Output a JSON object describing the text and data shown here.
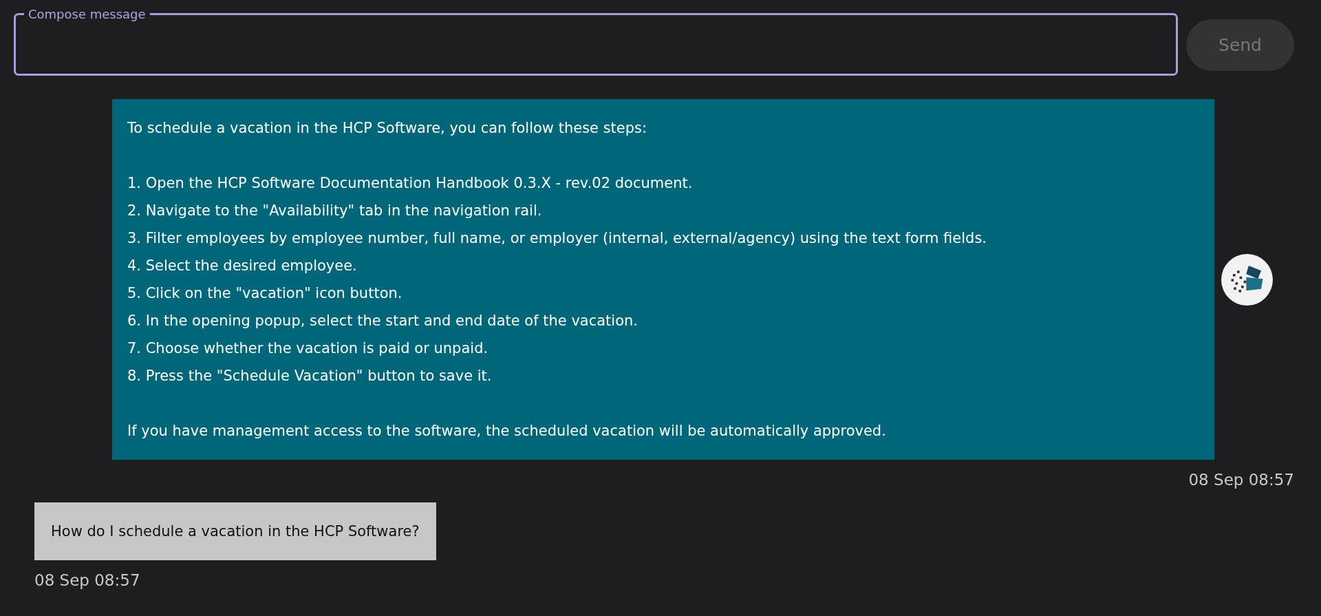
{
  "compose": {
    "label": "Compose message"
  },
  "send_button": {
    "label": "Send",
    "disabled": true
  },
  "messages": [
    {
      "kind": "bot",
      "intro": "To schedule a vacation in the HCP Software, you can follow these steps:",
      "steps": [
        "1. Open the HCP Software Documentation Handbook 0.3.X - rev.02 document.",
        "2. Navigate to the \"Availability\" tab in the navigation rail.",
        "3. Filter employees by employee number, full name, or employer (internal, external/agency) using the text form fields.",
        "4. Select the desired employee.",
        "5. Click on the \"vacation\" icon button.",
        "6. In the opening popup, select the start and end date of the vacation.",
        "7. Choose whether the vacation is paid or unpaid.",
        "8. Press the \"Schedule Vacation\" button to save it."
      ],
      "outro": "If you have management access to the software, the scheduled vacation will be automatically approved.",
      "time": "08 Sep 08:57"
    },
    {
      "kind": "user",
      "text": "How do I schedule a vacation in the HCP Software?",
      "time": "08 Sep 08:57"
    }
  ]
}
